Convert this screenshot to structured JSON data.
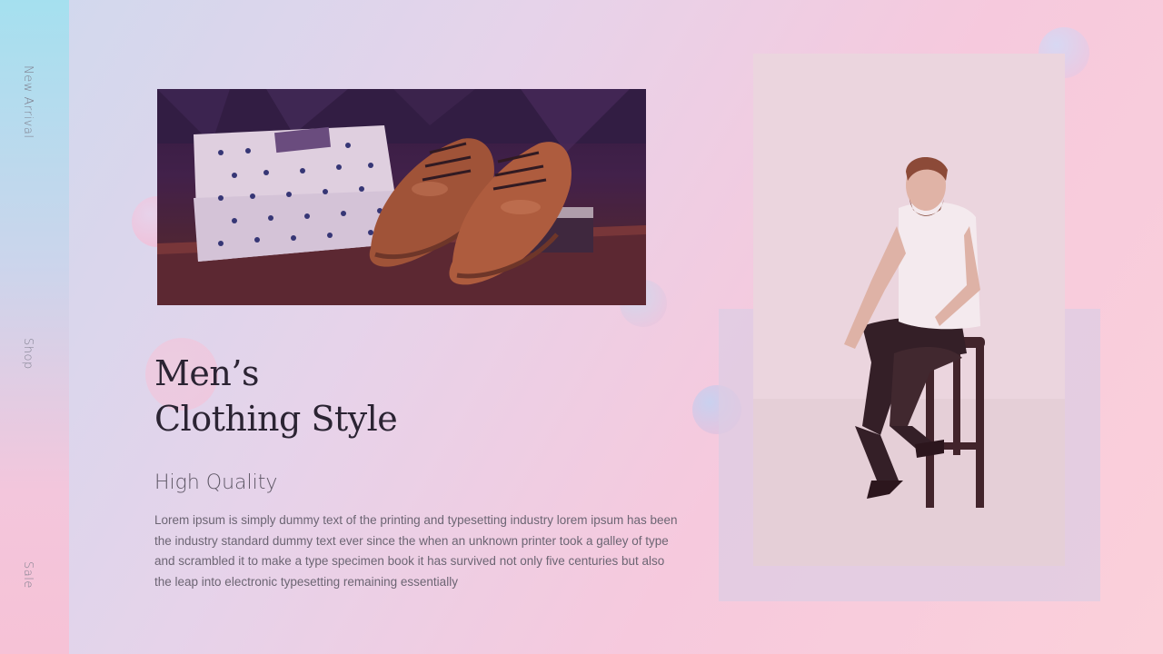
{
  "nav": {
    "items": [
      {
        "label": "New Arrival"
      },
      {
        "label": "Shop"
      },
      {
        "label": "Sale"
      }
    ]
  },
  "hero": {
    "title_line1": "Men’s",
    "title_line2": "Clothing Style",
    "subtitle": "High Quality",
    "body": "Lorem ipsum is simply dummy text of the printing and typesetting industry lorem ipsum has been the industry standard dummy text ever since the when an unknown printer took a galley of type and scrambled it to make a type specimen book it has survived not only five centuries but also the leap into electronic typesetting remaining essentially"
  },
  "images": {
    "shoes_photo": "photo-shirts-and-brown-oxford-shoes",
    "model_photo": "photo-bearded-man-sitting-on-stool"
  },
  "colors": {
    "title": "#2b2433",
    "text": "#6c6573",
    "nav": "#7f7f8e"
  }
}
